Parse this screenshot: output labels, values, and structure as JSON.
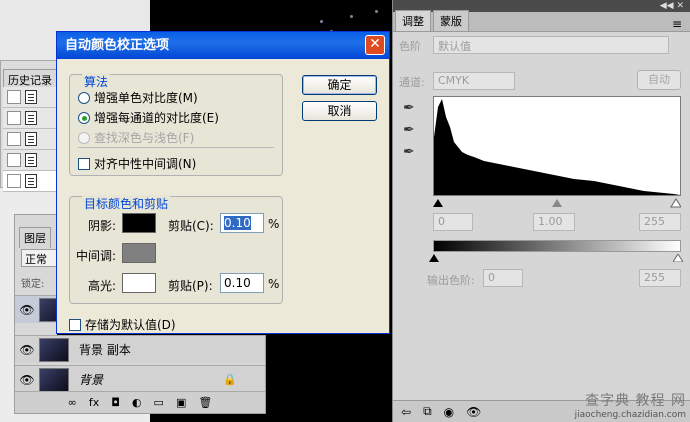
{
  "history": {
    "tab": "历史记录"
  },
  "layers": {
    "tab": "图层",
    "blend_mode": "正常",
    "lock_label": "锁定:",
    "items": [
      {
        "name": "背景 副本"
      },
      {
        "name": "背景"
      }
    ],
    "footer_icons": [
      "link-icon",
      "fx-icon",
      "mask-icon",
      "adjustment-icon",
      "folder-icon",
      "new-layer-icon",
      "trash-icon"
    ]
  },
  "adjust": {
    "tabs": [
      "调整",
      "蒙版"
    ],
    "preset_label": "色阶",
    "preset_value": "默认值",
    "channel_label": "通道:",
    "channel_value": "CMYK",
    "auto_button": "自动",
    "input_low": "0",
    "input_mid": "1.00",
    "input_high": "255",
    "output_label": "输出色阶:",
    "output_low": "0",
    "output_high": "255"
  },
  "dialog": {
    "title": "自动颜色校正选项",
    "algorithm_legend": "算法",
    "options": [
      {
        "label": "增强单色对比度(M)",
        "selected": false,
        "enabled": true
      },
      {
        "label": "增强每通道的对比度(E)",
        "selected": true,
        "enabled": true
      },
      {
        "label": "查找深色与浅色(F)",
        "selected": false,
        "enabled": false
      }
    ],
    "snap_neutral": "对齐中性中间调(N)",
    "target_legend": "目标颜色和剪贴",
    "shadows_label": "阴影:",
    "midtones_label": "中间调:",
    "highlights_label": "高光:",
    "clip_shadows_label": "剪贴(C):",
    "clip_shadows_value": "0.10",
    "clip_highlights_label": "剪贴(P):",
    "clip_highlights_value": "0.10",
    "percent": "%",
    "save_default": "存储为默认值(D)",
    "ok_button": "确定",
    "cancel_button": "取消",
    "colors": {
      "shadows": "#000000",
      "midtones": "#808080",
      "highlights": "#ffffff"
    }
  },
  "watermark": {
    "line1": "查字典 教程 网",
    "line2": "jiaocheng.chazidian.com"
  }
}
